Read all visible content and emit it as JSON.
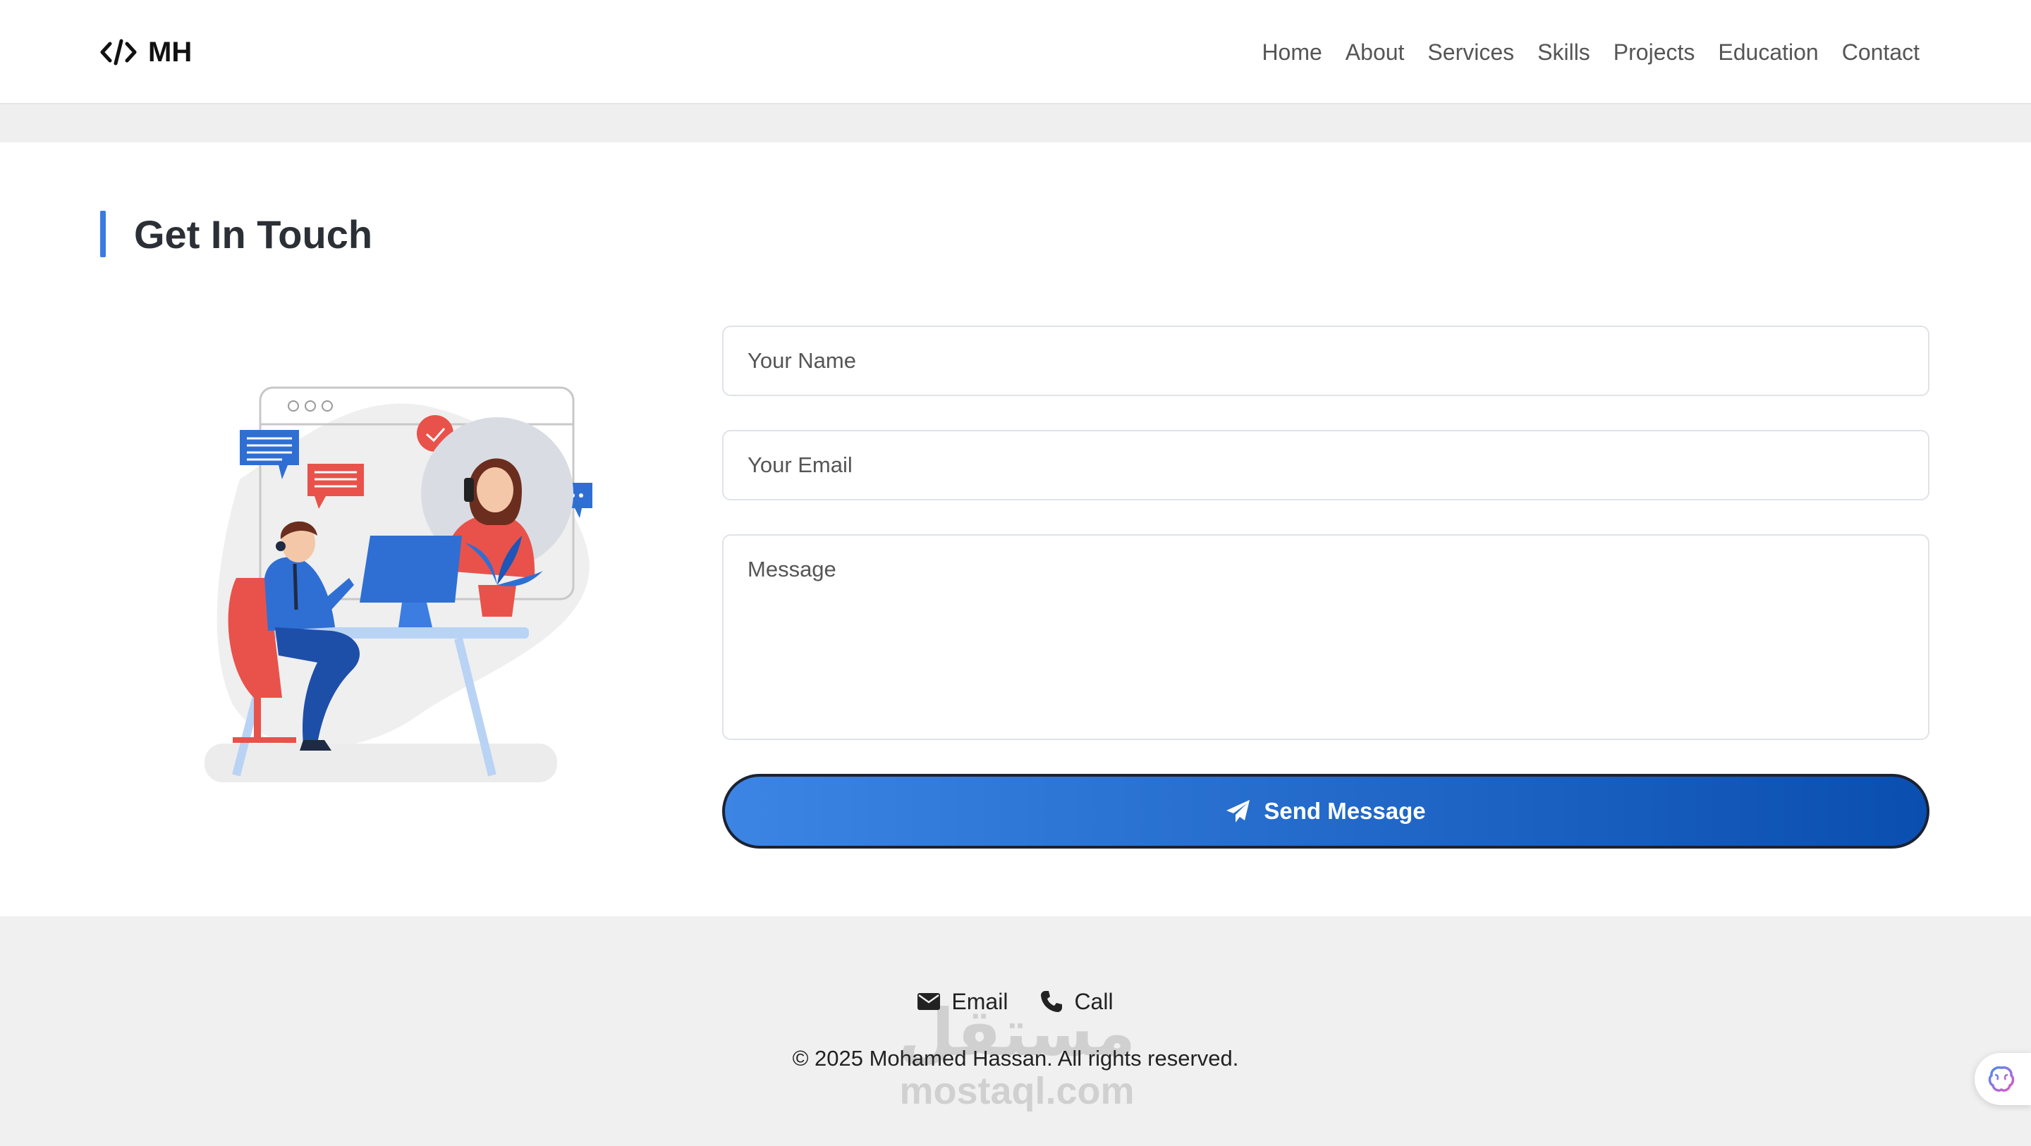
{
  "navbar": {
    "brand_symbol": "</>",
    "brand_text": "MH",
    "links": [
      {
        "label": "Home"
      },
      {
        "label": "About"
      },
      {
        "label": "Services"
      },
      {
        "label": "Skills"
      },
      {
        "label": "Projects"
      },
      {
        "label": "Education"
      },
      {
        "label": "Contact"
      }
    ]
  },
  "contact": {
    "title": "Get In Touch",
    "accent_color": "#3a7be0",
    "form": {
      "name_placeholder": "Your Name",
      "name_value": "",
      "email_placeholder": "Your Email",
      "email_value": "",
      "message_placeholder": "Message",
      "message_value": "",
      "submit_label": "Send Message",
      "submit_icon": "paper-plane-icon"
    },
    "illustration": "customer-support-illustration"
  },
  "footer": {
    "links": [
      {
        "label": "Email",
        "icon": "envelope-icon"
      },
      {
        "label": "Call",
        "icon": "phone-icon"
      }
    ],
    "copyright": "© 2025 Mohamed Hassan. All rights reserved."
  },
  "watermark": {
    "arabic": "مستقل",
    "latin": "mostaql.com"
  },
  "widget": {
    "icon": "brain-icon"
  }
}
